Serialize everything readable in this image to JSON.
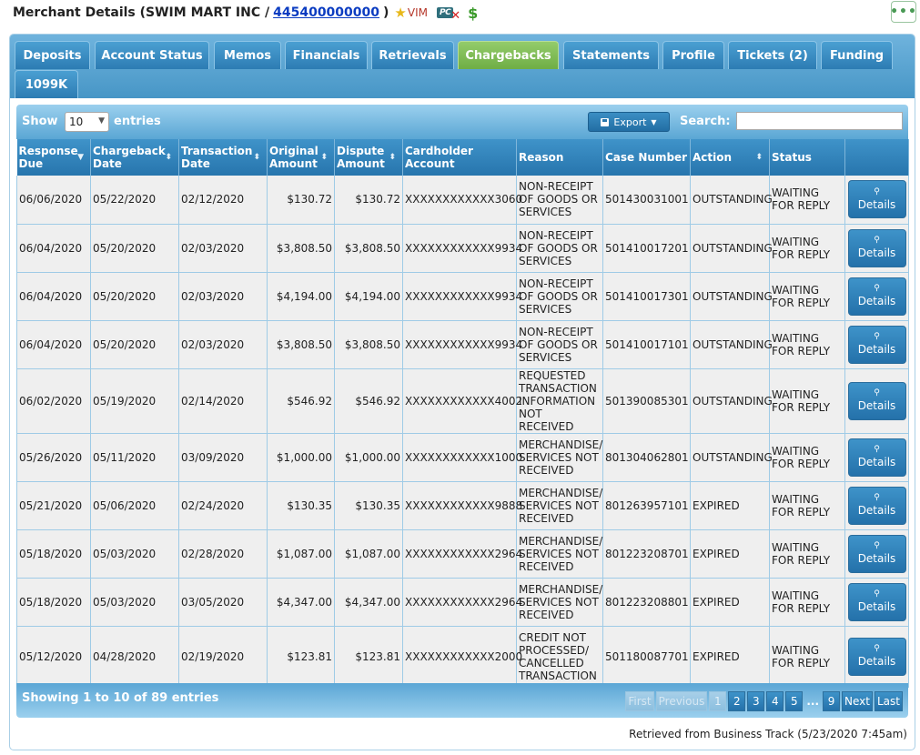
{
  "header": {
    "title_prefix": "Merchant Details (SWIM MART INC /",
    "mid": "445400000000",
    "title_suffix": ")",
    "vim_label": "VIM",
    "pc_label": "PC",
    "more_label": "•••"
  },
  "tabs": [
    {
      "label": "Deposits",
      "active": false
    },
    {
      "label": "Account Status",
      "active": false
    },
    {
      "label": "Memos",
      "active": false
    },
    {
      "label": "Financials",
      "active": false
    },
    {
      "label": "Retrievals",
      "active": false
    },
    {
      "label": "Chargebacks",
      "active": true
    },
    {
      "label": "Statements",
      "active": false
    },
    {
      "label": "Profile",
      "active": false
    },
    {
      "label": "Tickets (2)",
      "active": false
    },
    {
      "label": "Funding",
      "active": false
    },
    {
      "label": "1099K",
      "active": false
    }
  ],
  "toolbar": {
    "show_label": "Show",
    "entries_label": "entries",
    "page_length": "10",
    "export_label": "Export",
    "search_label": "Search:",
    "search_value": ""
  },
  "columns": [
    "Response Due",
    "Chargeback Date",
    "Transaction Date",
    "Original Amount",
    "Dispute Amount",
    "Cardholder Account",
    "Reason",
    "Case Number",
    "Action",
    "Status",
    ""
  ],
  "rows": [
    {
      "response_due": "06/06/2020",
      "chargeback_date": "05/22/2020",
      "transaction_date": "02/12/2020",
      "original_amount": "$130.72",
      "dispute_amount": "$130.72",
      "cardholder_account": "XXXXXXXXXXXX3060",
      "reason": "NON-RECEIPT OF GOODS OR SERVICES",
      "case_number": "501430031001",
      "action": "OUTSTANDING",
      "status": "WAITING FOR REPLY",
      "details_label": "Details"
    },
    {
      "response_due": "06/04/2020",
      "chargeback_date": "05/20/2020",
      "transaction_date": "02/03/2020",
      "original_amount": "$3,808.50",
      "dispute_amount": "$3,808.50",
      "cardholder_account": "XXXXXXXXXXXX9934",
      "reason": "NON-RECEIPT OF GOODS OR SERVICES",
      "case_number": "501410017201",
      "action": "OUTSTANDING",
      "status": "WAITING FOR REPLY",
      "details_label": "Details"
    },
    {
      "response_due": "06/04/2020",
      "chargeback_date": "05/20/2020",
      "transaction_date": "02/03/2020",
      "original_amount": "$4,194.00",
      "dispute_amount": "$4,194.00",
      "cardholder_account": "XXXXXXXXXXXX9934",
      "reason": "NON-RECEIPT OF GOODS OR SERVICES",
      "case_number": "501410017301",
      "action": "OUTSTANDING",
      "status": "WAITING FOR REPLY",
      "details_label": "Details"
    },
    {
      "response_due": "06/04/2020",
      "chargeback_date": "05/20/2020",
      "transaction_date": "02/03/2020",
      "original_amount": "$3,808.50",
      "dispute_amount": "$3,808.50",
      "cardholder_account": "XXXXXXXXXXXX9934",
      "reason": "NON-RECEIPT OF GOODS OR SERVICES",
      "case_number": "501410017101",
      "action": "OUTSTANDING",
      "status": "WAITING FOR REPLY",
      "details_label": "Details"
    },
    {
      "response_due": "06/02/2020",
      "chargeback_date": "05/19/2020",
      "transaction_date": "02/14/2020",
      "original_amount": "$546.92",
      "dispute_amount": "$546.92",
      "cardholder_account": "XXXXXXXXXXXX4002",
      "reason": "REQUESTED TRANSACTION INFORMATION NOT RECEIVED",
      "case_number": "501390085301",
      "action": "OUTSTANDING",
      "status": "WAITING FOR REPLY",
      "details_label": "Details"
    },
    {
      "response_due": "05/26/2020",
      "chargeback_date": "05/11/2020",
      "transaction_date": "03/09/2020",
      "original_amount": "$1,000.00",
      "dispute_amount": "$1,000.00",
      "cardholder_account": "XXXXXXXXXXXX1000",
      "reason": "MERCHANDISE/ SERVICES NOT RECEIVED",
      "case_number": "801304062801",
      "action": "OUTSTANDING",
      "status": "WAITING FOR REPLY",
      "details_label": "Details"
    },
    {
      "response_due": "05/21/2020",
      "chargeback_date": "05/06/2020",
      "transaction_date": "02/24/2020",
      "original_amount": "$130.35",
      "dispute_amount": "$130.35",
      "cardholder_account": "XXXXXXXXXXXX9888",
      "reason": "MERCHANDISE/ SERVICES NOT RECEIVED",
      "case_number": "801263957101",
      "action": "EXPIRED",
      "status": "WAITING FOR REPLY",
      "details_label": "Details"
    },
    {
      "response_due": "05/18/2020",
      "chargeback_date": "05/03/2020",
      "transaction_date": "02/28/2020",
      "original_amount": "$1,087.00",
      "dispute_amount": "$1,087.00",
      "cardholder_account": "XXXXXXXXXXXX2964",
      "reason": "MERCHANDISE/ SERVICES NOT RECEIVED",
      "case_number": "801223208701",
      "action": "EXPIRED",
      "status": "WAITING FOR REPLY",
      "details_label": "Details"
    },
    {
      "response_due": "05/18/2020",
      "chargeback_date": "05/03/2020",
      "transaction_date": "03/05/2020",
      "original_amount": "$4,347.00",
      "dispute_amount": "$4,347.00",
      "cardholder_account": "XXXXXXXXXXXX2964",
      "reason": "MERCHANDISE/ SERVICES NOT RECEIVED",
      "case_number": "801223208801",
      "action": "EXPIRED",
      "status": "WAITING FOR REPLY",
      "details_label": "Details"
    },
    {
      "response_due": "05/12/2020",
      "chargeback_date": "04/28/2020",
      "transaction_date": "02/19/2020",
      "original_amount": "$123.81",
      "dispute_amount": "$123.81",
      "cardholder_account": "XXXXXXXXXXXX2000",
      "reason": "CREDIT NOT PROCESSED/ CANCELLED TRANSACTION",
      "case_number": "501180087701",
      "action": "EXPIRED",
      "status": "WAITING FOR REPLY",
      "details_label": "Details"
    }
  ],
  "footer": {
    "info": "Showing 1 to 10 of 89 entries",
    "pager": [
      {
        "label": "First",
        "state": "disabled"
      },
      {
        "label": "Previous",
        "state": "disabled"
      },
      {
        "label": "1",
        "state": "current"
      },
      {
        "label": "2",
        "state": "normal"
      },
      {
        "label": "3",
        "state": "normal"
      },
      {
        "label": "4",
        "state": "normal"
      },
      {
        "label": "5",
        "state": "normal"
      },
      {
        "label": "...",
        "state": "ellipsis"
      },
      {
        "label": "9",
        "state": "normal"
      },
      {
        "label": "Next",
        "state": "normal"
      },
      {
        "label": "Last",
        "state": "normal"
      }
    ]
  },
  "retrieved": "Retrieved from Business Track (5/23/2020 7:45am)",
  "colors": {
    "tab_blue": "#2d7cb3",
    "tab_active_green": "#6fae45",
    "link_blue": "#0b3cc1",
    "dollar_green": "#3a9a2a"
  }
}
